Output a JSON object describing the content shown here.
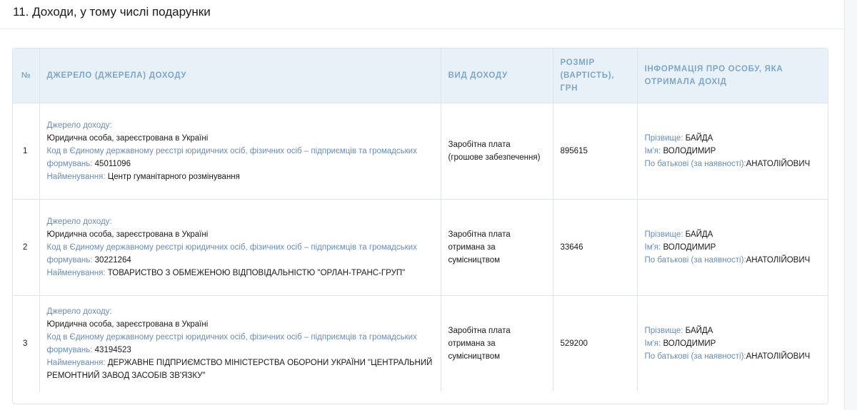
{
  "section": {
    "title": "11. Доходи, у тому числі подарунки"
  },
  "table": {
    "headers": {
      "num": "№",
      "source": "ДЖЕРЕЛО (ДЖЕРЕЛА) ДОХОДУ",
      "type": "ВИД ДОХОДУ",
      "amount": "РОЗМІР (ВАРТІСТЬ), ГРН",
      "person": "ІНФОРМАЦІЯ ПРО ОСОБУ, ЯКА ОТРИМАЛА ДОХІД"
    },
    "labels": {
      "source_title": "Джерело доходу:",
      "code": "Код в Єдиному державному реєстрі юридичних осіб, фізичних осіб – підприємців та громадських формувань:",
      "name": "Найменування:",
      "surname": "Прізвище:",
      "given_name": "Ім'я:",
      "patronymic": "По батькові (за наявності):"
    },
    "rows": [
      {
        "num": "1",
        "source_type": "Юридична особа, зареєстрована в Україні",
        "code": "45011096",
        "name": "Центр гуманітарного розмінування",
        "income_type": "Заробітна плата (грошове забезпечення)",
        "amount": "895615",
        "surname": "БАЙДА",
        "given_name": "ВОЛОДИМИР",
        "patronymic": "АНАТОЛІЙОВИЧ"
      },
      {
        "num": "2",
        "source_type": "Юридична особа, зареєстрована в Україні",
        "code": "30221264",
        "name": "ТОВАРИСТВО З ОБМЕЖЕНОЮ ВІДПОВІДАЛЬНІСТЮ \"ОРЛАН-ТРАНС-ГРУП\"",
        "income_type": "Заробітна плата отримана за сумісництвом",
        "amount": "33646",
        "surname": "БАЙДА",
        "given_name": "ВОЛОДИМИР",
        "patronymic": "АНАТОЛІЙОВИЧ"
      },
      {
        "num": "3",
        "source_type": "Юридична особа, зареєстрована в Україні",
        "code": "43194523",
        "name": "ДЕРЖАВНЕ ПІДПРИЄМСТВО МІНІСТЕРСТВА ОБОРОНИ УКРАЇНИ \"ЦЕНТРАЛЬНИЙ РЕМОНТНИЙ ЗАВОД ЗАСОБІВ ЗВ'ЯЗКУ\"",
        "income_type": "Заробітна плата отримана за сумісництвом",
        "amount": "529200",
        "surname": "БАЙДА",
        "given_name": "ВОЛОДИМИР",
        "patronymic": "АНАТОЛІЙОВИЧ"
      }
    ]
  }
}
